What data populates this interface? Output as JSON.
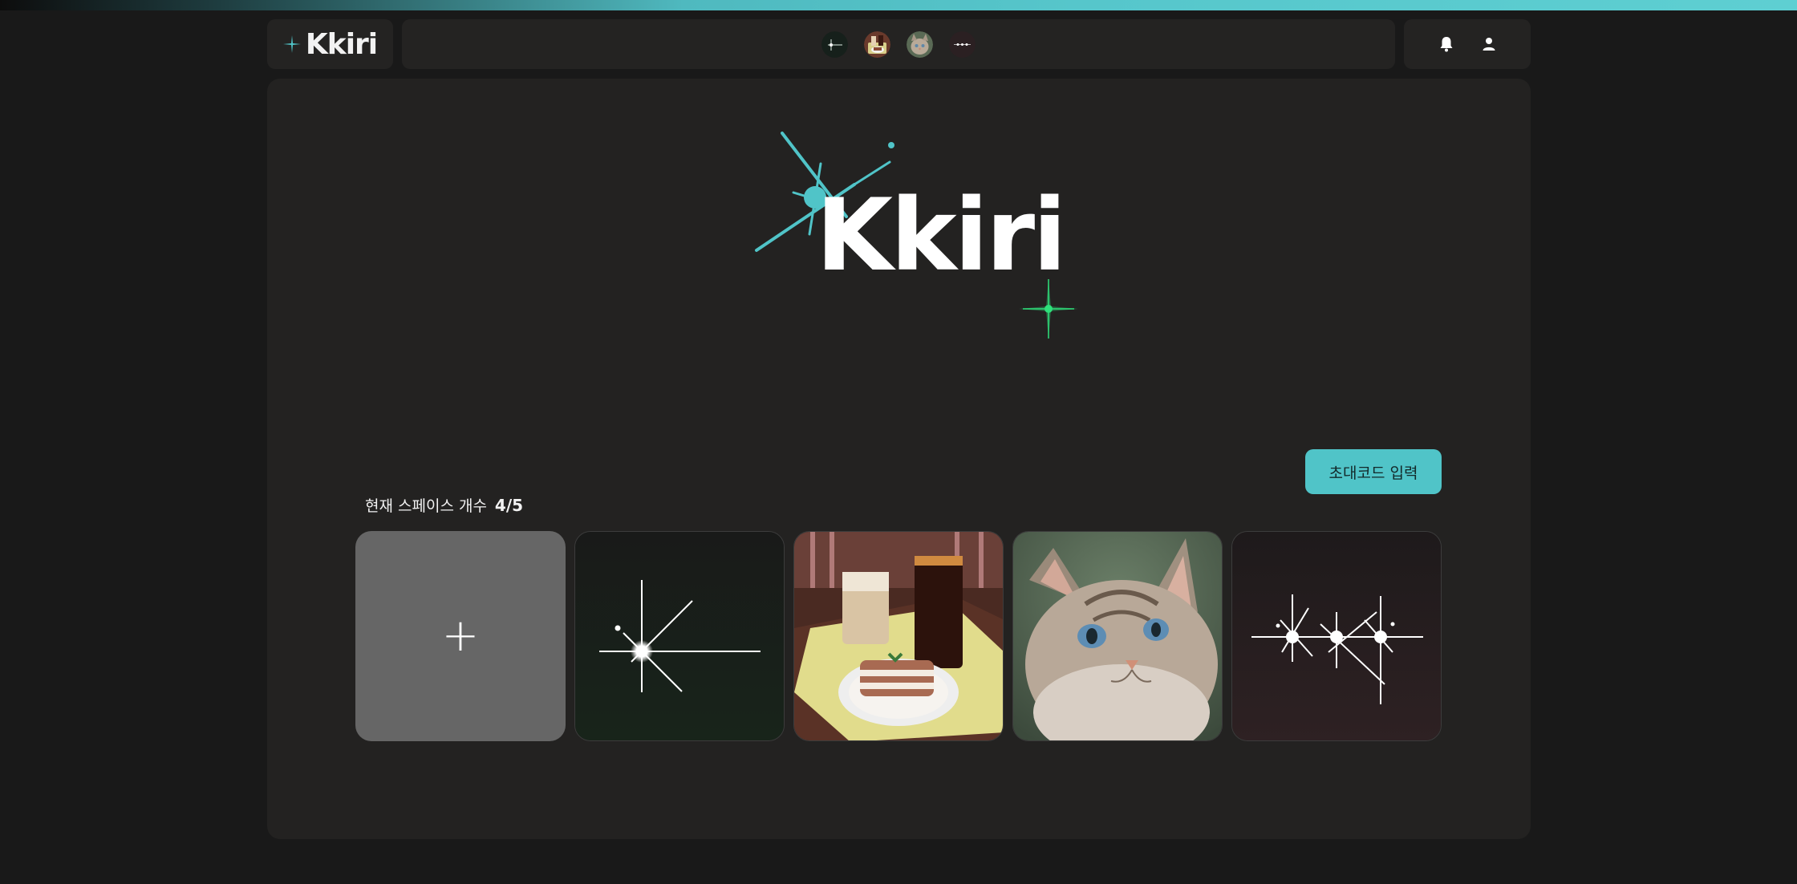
{
  "header": {
    "logo_text": "Kkiri",
    "spaces": [
      {
        "name": "space-sparkle-green"
      },
      {
        "name": "space-cafe-dessert"
      },
      {
        "name": "space-cat"
      },
      {
        "name": "space-sparkle-triple"
      }
    ]
  },
  "hero": {
    "title": "Kkiri"
  },
  "main": {
    "invite_button_label": "초대코드 입력",
    "space_count_label": "현재 스페이스 개수",
    "space_count_value": "4/5",
    "add_symbol": "+"
  },
  "colors": {
    "accent": "#50c4c8",
    "accent_green": "#2ee07a",
    "background": "#191919",
    "panel": "#232221"
  },
  "progress": 1.0
}
